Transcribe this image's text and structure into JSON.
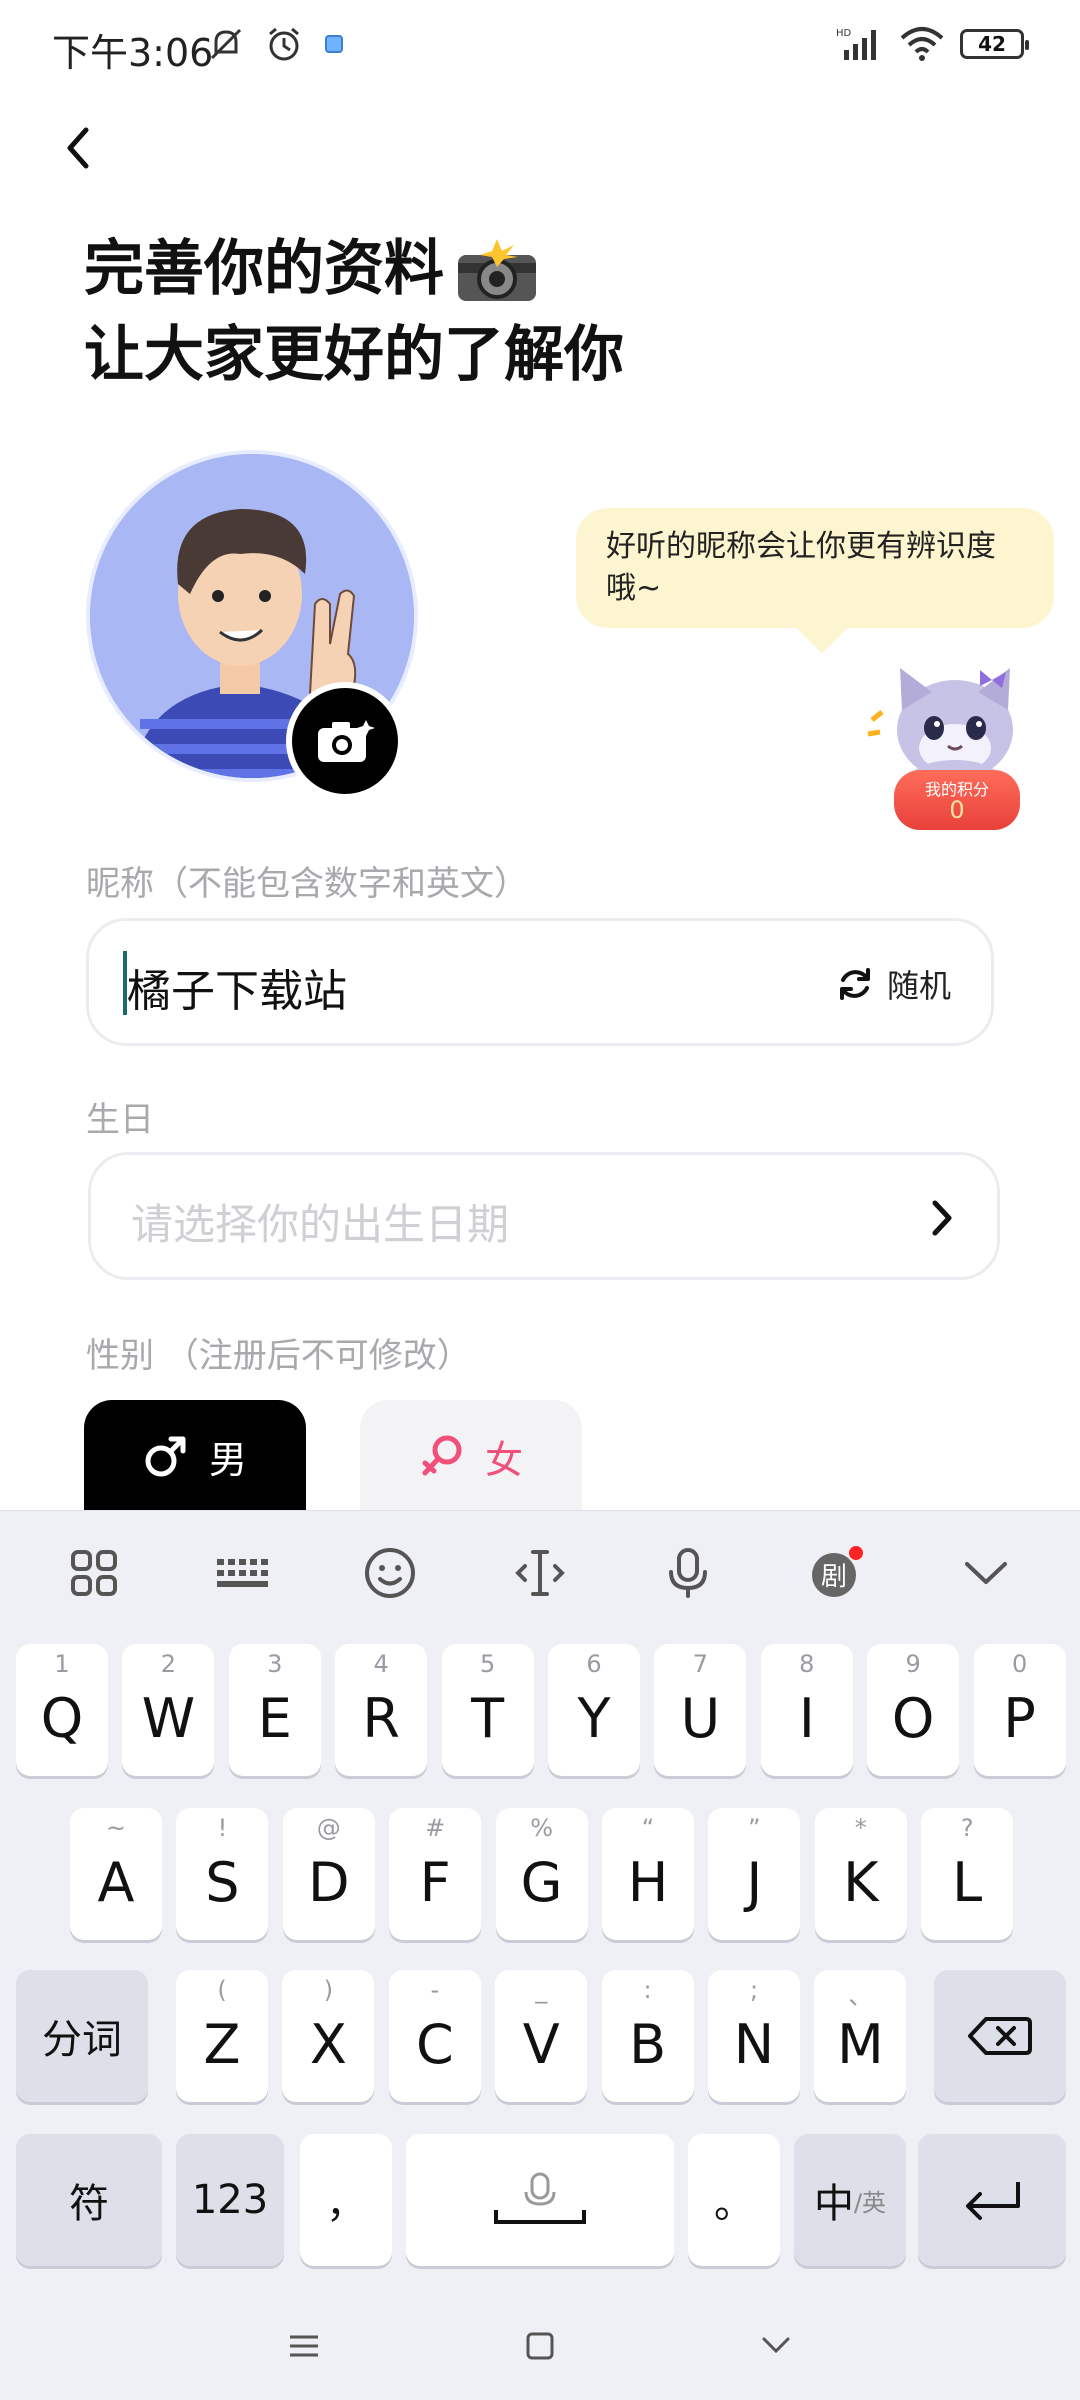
{
  "status_bar": {
    "time": "下午3:06",
    "battery": "42"
  },
  "header": {
    "title_line1": "完善你的资料",
    "title_line2": "让大家更好的了解你"
  },
  "tip_bubble": {
    "text": "好听的昵称会让你更有辨识度哦~"
  },
  "points_badge": {
    "label": "我的积分",
    "value": "0"
  },
  "nickname": {
    "label": "昵称（不能包含数字和英文）",
    "value": "橘子下载站",
    "random_label": "随机"
  },
  "birthday": {
    "label": "生日",
    "placeholder": "请选择你的出生日期"
  },
  "gender": {
    "label": "性别 （注册后不可修改）",
    "male_label": "男",
    "female_label": "女",
    "selected": "male"
  },
  "keyboard": {
    "toolbar_icons": [
      "apps-grid-icon",
      "keyboard-icon",
      "emoji-icon",
      "cursor-icon",
      "microphone-icon",
      "drama-icon",
      "collapse-icon"
    ],
    "row1": [
      {
        "key": "Q",
        "hint": "1"
      },
      {
        "key": "W",
        "hint": "2"
      },
      {
        "key": "E",
        "hint": "3"
      },
      {
        "key": "R",
        "hint": "4"
      },
      {
        "key": "T",
        "hint": "5"
      },
      {
        "key": "Y",
        "hint": "6"
      },
      {
        "key": "U",
        "hint": "7"
      },
      {
        "key": "I",
        "hint": "8"
      },
      {
        "key": "O",
        "hint": "9"
      },
      {
        "key": "P",
        "hint": "0"
      }
    ],
    "row2": [
      {
        "key": "A",
        "hint": "~"
      },
      {
        "key": "S",
        "hint": "!"
      },
      {
        "key": "D",
        "hint": "@"
      },
      {
        "key": "F",
        "hint": "#"
      },
      {
        "key": "G",
        "hint": "%"
      },
      {
        "key": "H",
        "hint": "“"
      },
      {
        "key": "J",
        "hint": "”"
      },
      {
        "key": "K",
        "hint": "*"
      },
      {
        "key": "L",
        "hint": "?"
      }
    ],
    "row3": [
      {
        "key": "Z",
        "hint": "("
      },
      {
        "key": "X",
        "hint": ")"
      },
      {
        "key": "C",
        "hint": "-"
      },
      {
        "key": "V",
        "hint": "_"
      },
      {
        "key": "B",
        "hint": ":"
      },
      {
        "key": "N",
        "hint": ";"
      },
      {
        "key": "M",
        "hint": "、"
      }
    ],
    "segment_label": "分词",
    "symbols_label": "符",
    "numbers_label": "123",
    "comma_label": "，",
    "period_label": "。",
    "lang_label": "中",
    "lang_sub_label": "/英"
  }
}
